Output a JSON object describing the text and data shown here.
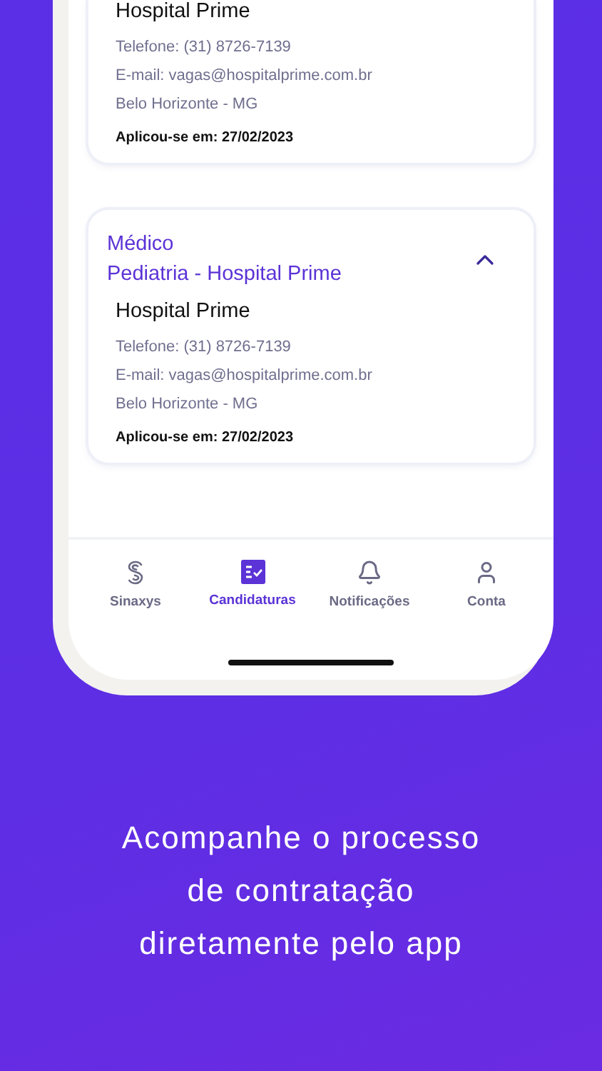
{
  "applications": [
    {
      "company": "Hospital Prime",
      "phone": "Telefone: (31) 8726-7139",
      "email": "E-mail: vagas@hospitalprime.com.br",
      "location": "Belo Horizonte - MG",
      "applied": "Aplicou-se em: 27/02/2023"
    },
    {
      "role": "Médico",
      "title": "Pediatria - Hospital Prime",
      "expanded": true,
      "company": "Hospital Prime",
      "phone": "Telefone: (31) 8726-7139",
      "email": "E-mail: vagas@hospitalprime.com.br",
      "location": "Belo Horizonte - MG",
      "applied": "Aplicou-se em: 27/02/2023"
    }
  ],
  "tab_bar": [
    {
      "kind": "logo",
      "label": "Sinaxys",
      "selected": false
    },
    {
      "kind": "applications",
      "label": "Candidaturas",
      "selected": true
    },
    {
      "kind": "notifications",
      "label": "Notificações",
      "selected": false
    },
    {
      "kind": "account",
      "label": "Conta",
      "selected": false
    }
  ],
  "caption": [
    "Acompanhe o processo",
    "de contratação",
    "diretamente pelo app"
  ]
}
